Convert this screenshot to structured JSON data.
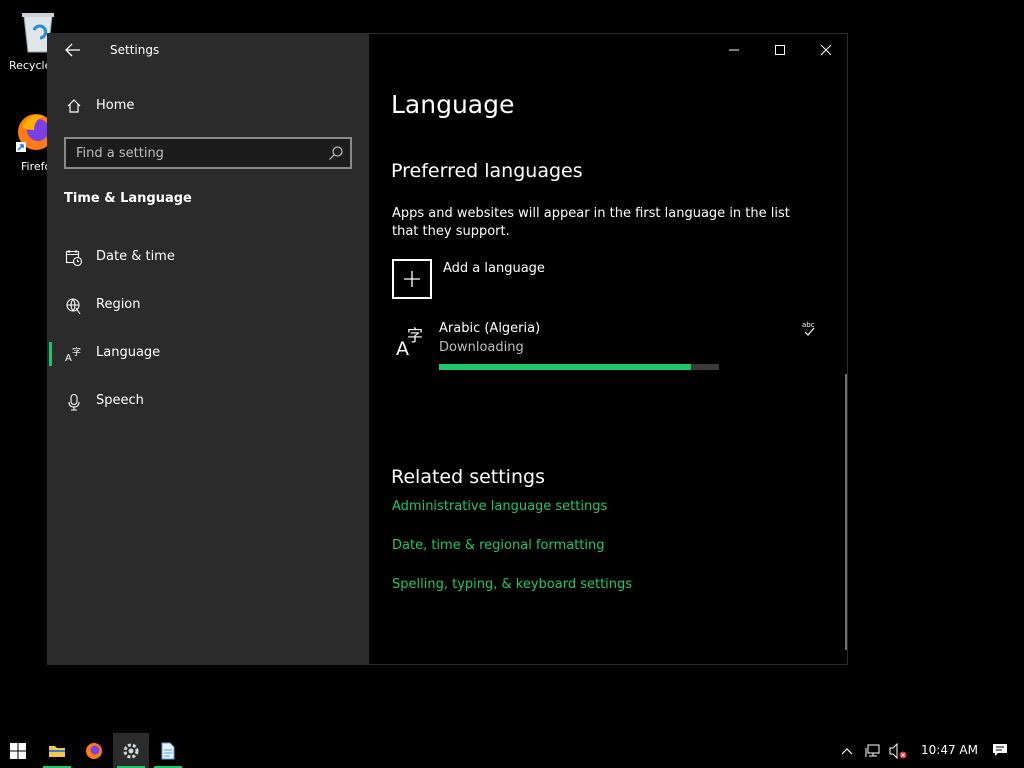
{
  "desktop": {
    "recycle_label": "Recycle",
    "firefox_label": "Firefo"
  },
  "window": {
    "app_title": "Settings",
    "sidebar": {
      "home_label": "Home",
      "search_placeholder": "Find a setting",
      "section_title": "Time & Language",
      "items": [
        {
          "label": "Date & time",
          "icon": "clock-calendar-icon"
        },
        {
          "label": "Region",
          "icon": "globe-icon"
        },
        {
          "label": "Language",
          "icon": "language-icon",
          "selected": true
        },
        {
          "label": "Speech",
          "icon": "microphone-icon"
        }
      ]
    },
    "main": {
      "page_title": "Language",
      "preferred_heading": "Preferred languages",
      "preferred_description": "Apps and websites will appear in the first language in the list that they support.",
      "add_language_label": "Add a language",
      "language_item": {
        "name": "Arabic (Algeria)",
        "status": "Downloading",
        "progress_percent": 90
      },
      "related_heading": "Related settings",
      "links": [
        "Administrative language settings",
        "Date, time & regional formatting",
        "Spelling, typing, & keyboard settings"
      ]
    }
  },
  "taskbar": {
    "time": "10:47 AM"
  },
  "colors": {
    "accent": "#1ec66a",
    "sidebar_bg": "#2b2b2b",
    "main_bg": "#000000"
  }
}
